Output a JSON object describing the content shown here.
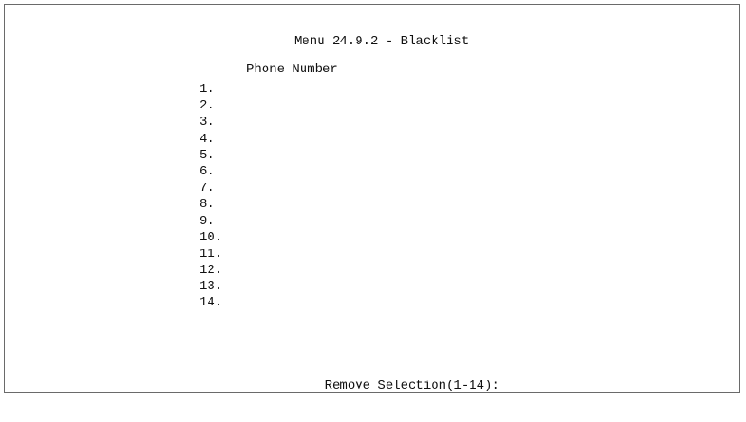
{
  "menu": {
    "title": "Menu 24.9.2 - Blacklist",
    "column_header": "Phone Number",
    "entries": [
      {
        "number": "1.",
        "value": ""
      },
      {
        "number": "2.",
        "value": ""
      },
      {
        "number": "3.",
        "value": ""
      },
      {
        "number": "4.",
        "value": ""
      },
      {
        "number": "5.",
        "value": ""
      },
      {
        "number": "6.",
        "value": ""
      },
      {
        "number": "7.",
        "value": ""
      },
      {
        "number": "8.",
        "value": ""
      },
      {
        "number": "9.",
        "value": ""
      },
      {
        "number": "10.",
        "value": ""
      },
      {
        "number": "11.",
        "value": ""
      },
      {
        "number": "12.",
        "value": ""
      },
      {
        "number": "13.",
        "value": ""
      },
      {
        "number": "14.",
        "value": ""
      }
    ],
    "prompt": "Remove Selection(1-14):",
    "prompt_value": ""
  }
}
